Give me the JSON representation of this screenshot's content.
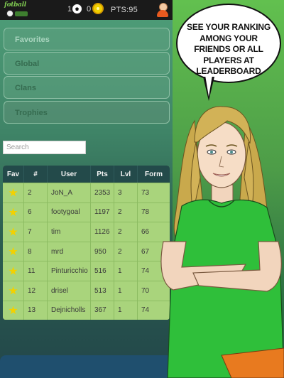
{
  "topbar": {
    "logo_text": "fotball",
    "stat1": "1",
    "stat2": "0",
    "points": "PTS:95"
  },
  "menu": {
    "items": [
      {
        "label": "Favorites"
      },
      {
        "label": "Global"
      },
      {
        "label": "Clans"
      },
      {
        "label": "Trophies"
      }
    ]
  },
  "search": {
    "placeholder": "Search",
    "value": ""
  },
  "leaderboard": {
    "headers": [
      "Fav",
      "#",
      "User",
      "Pts",
      "Lvl",
      "Form"
    ],
    "rows": [
      {
        "rank": "2",
        "user": "JoN_A",
        "pts": "2353",
        "lvl": "3",
        "form": "73"
      },
      {
        "rank": "6",
        "user": "footygoal",
        "pts": "1197",
        "lvl": "2",
        "form": "78"
      },
      {
        "rank": "7",
        "user": "tim",
        "pts": "1126",
        "lvl": "2",
        "form": "66"
      },
      {
        "rank": "8",
        "user": "mrd",
        "pts": "950",
        "lvl": "2",
        "form": "67"
      },
      {
        "rank": "11",
        "user": "Pinturicchio",
        "pts": "516",
        "lvl": "1",
        "form": "74"
      },
      {
        "rank": "12",
        "user": "drisel",
        "pts": "513",
        "lvl": "1",
        "form": "70"
      },
      {
        "rank": "13",
        "user": "Dejnicholls",
        "pts": "367",
        "lvl": "1",
        "form": "74"
      }
    ]
  },
  "promo": {
    "bubble_text": "SEE YOUR RANKING AMONG YOUR FRIENDS OR ALL PLAYERS AT LEADERBOARD"
  },
  "colors": {
    "header_bg": "#234a4a",
    "row_bg": "#a9d47c",
    "star": "#f3d100",
    "shirt": "#2fbf3a"
  }
}
